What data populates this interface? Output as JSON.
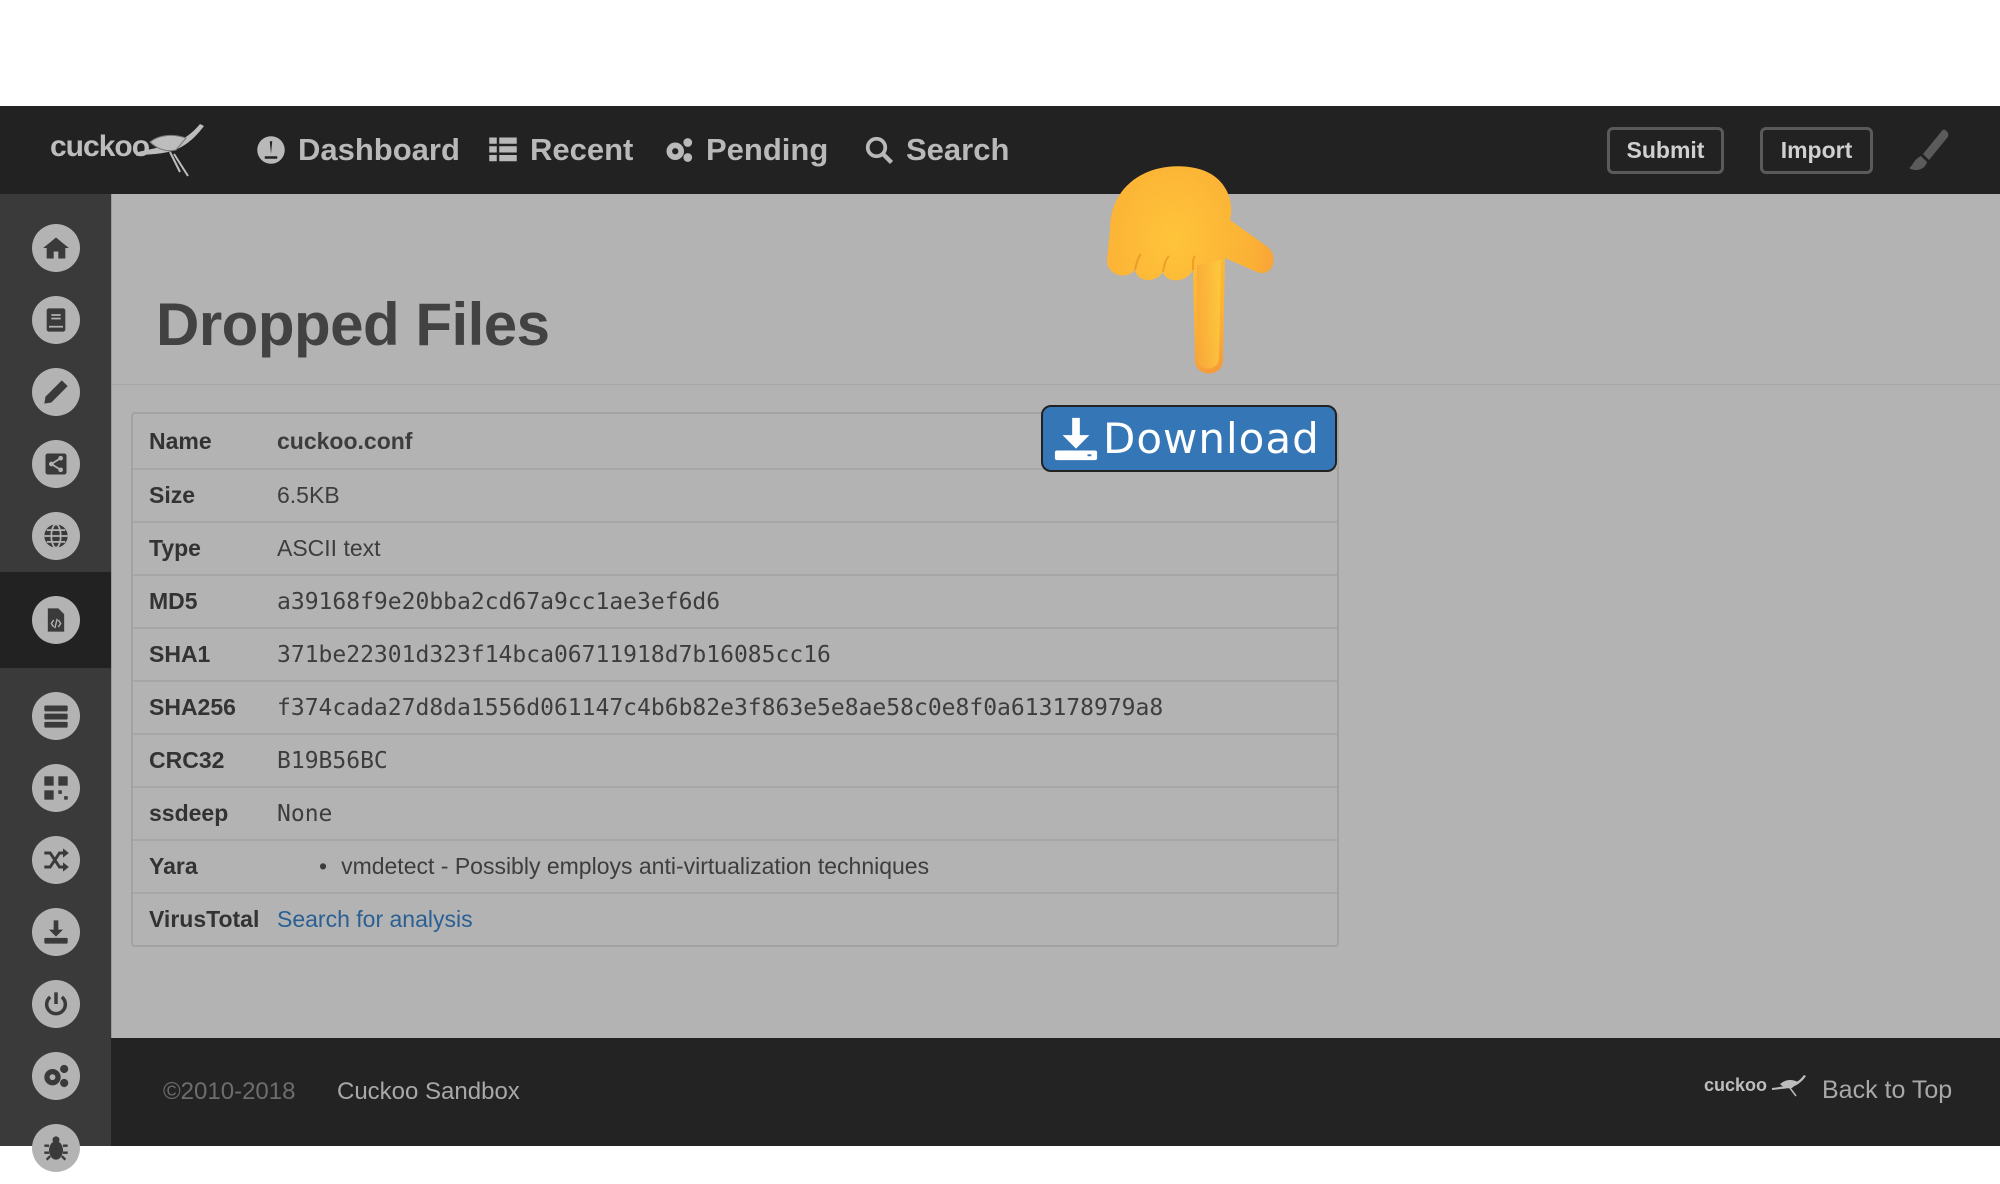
{
  "header": {
    "logo_text": "cuckoo",
    "nav": [
      {
        "label": "Dashboard",
        "icon": "dashboard-icon"
      },
      {
        "label": "Recent",
        "icon": "list-icon"
      },
      {
        "label": "Pending",
        "icon": "gears-icon"
      },
      {
        "label": "Search",
        "icon": "search-icon"
      }
    ],
    "submit_label": "Submit",
    "import_label": "Import",
    "theme_icon": "paintbrush-icon"
  },
  "sidebar": {
    "items": [
      {
        "icon": "home-icon",
        "active": false
      },
      {
        "icon": "book-icon",
        "active": false
      },
      {
        "icon": "pencil-icon",
        "active": false
      },
      {
        "icon": "share-icon",
        "active": false
      },
      {
        "icon": "globe-icon",
        "active": false
      },
      {
        "icon": "file-code-icon",
        "active": true
      },
      {
        "icon": "server-icon",
        "active": false
      },
      {
        "icon": "qrcode-icon",
        "active": false
      },
      {
        "icon": "shuffle-icon",
        "active": false
      },
      {
        "icon": "download-icon",
        "active": false
      },
      {
        "icon": "power-icon",
        "active": false
      },
      {
        "icon": "cogs-icon",
        "active": false
      },
      {
        "icon": "bug-icon",
        "active": false
      }
    ]
  },
  "main": {
    "title": "Dropped Files",
    "file": {
      "rows": [
        {
          "key": "Name",
          "value": "cuckoo.conf"
        },
        {
          "key": "Size",
          "value": "6.5KB"
        },
        {
          "key": "Type",
          "value": "ASCII text"
        },
        {
          "key": "MD5",
          "value": "a39168f9e20bba2cd67a9cc1ae3ef6d6"
        },
        {
          "key": "SHA1",
          "value": "371be22301d323f14bca06711918d7b16085cc16"
        },
        {
          "key": "SHA256",
          "value": "f374cada27d8da1556d061147c4b6b82e3f863e5e8ae58c0e8f0a613178979a8"
        },
        {
          "key": "CRC32",
          "value": "B19B56BC"
        },
        {
          "key": "ssdeep",
          "value": "None"
        },
        {
          "key": "Yara",
          "value": "vmdetect - Possibly employs anti-virtualization techniques"
        },
        {
          "key": "VirusTotal",
          "value": "Search for analysis"
        }
      ]
    },
    "download_label": "Download",
    "colors": {
      "download_bg": "#3577b6",
      "link": "#2a5f94"
    }
  },
  "overlay": {
    "pointer": "pointing-down-hand"
  },
  "footer": {
    "copyright": "©2010-2018",
    "brand": "Cuckoo Sandbox",
    "logo_text": "cuckoo",
    "back_to_top": "Back to Top"
  }
}
